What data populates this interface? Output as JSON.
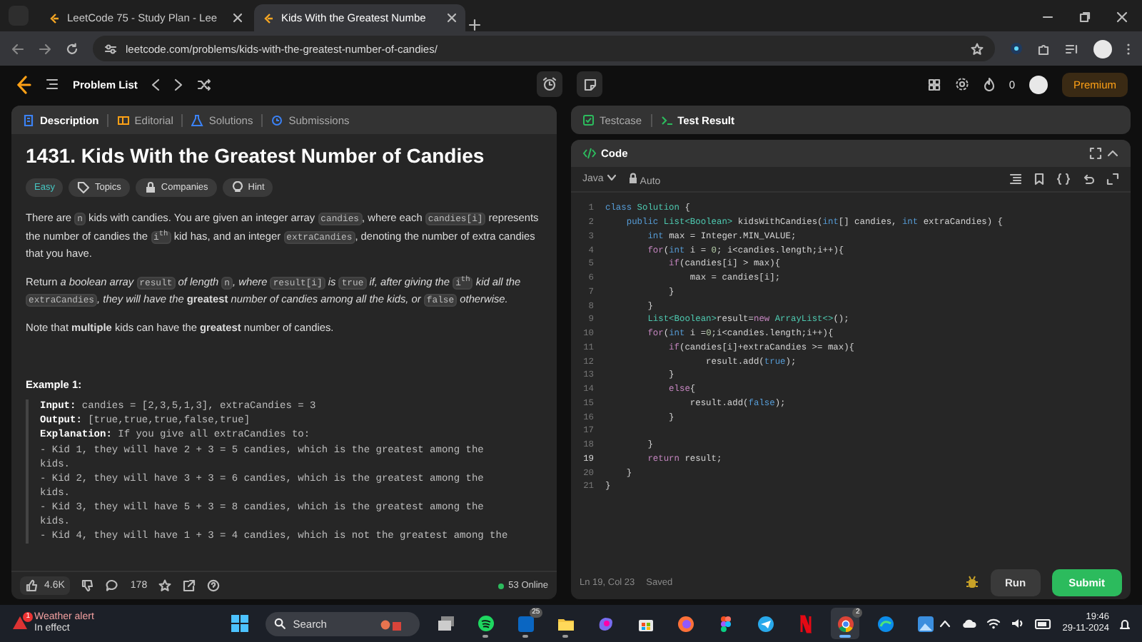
{
  "browser": {
    "tabs": [
      {
        "title": "LeetCode 75 - Study Plan - Lee",
        "selected": false
      },
      {
        "title": "Kids With the Greatest Numbe",
        "selected": true
      }
    ],
    "url": "leetcode.com/problems/kids-with-the-greatest-number-of-candies/"
  },
  "navbar": {
    "problem_list": "Problem List",
    "streak": "0",
    "premium": "Premium"
  },
  "description_panel": {
    "tabs": [
      {
        "label": "Description",
        "kind": "doc",
        "selected": true
      },
      {
        "label": "Editorial",
        "kind": "book",
        "selected": false
      },
      {
        "label": "Solutions",
        "kind": "flask",
        "selected": false
      },
      {
        "label": "Submissions",
        "kind": "clock",
        "selected": false
      }
    ],
    "title": "1431. Kids With the Greatest Number of Candies",
    "difficulty": "Easy",
    "chips": [
      {
        "label": "Topics",
        "kind": "tag"
      },
      {
        "label": "Companies",
        "kind": "lock"
      },
      {
        "label": "Hint",
        "kind": "bulb"
      }
    ],
    "paragraphs": [
      [
        {
          "kind": "text",
          "text": "There are "
        },
        {
          "kind": "code",
          "text": "n"
        },
        {
          "kind": "text",
          "text": " kids with candies. You are given an integer array "
        },
        {
          "kind": "code",
          "text": "candies"
        },
        {
          "kind": "text",
          "text": ", where each "
        },
        {
          "kind": "code",
          "text": "candies[i]"
        },
        {
          "kind": "text",
          "text": " represents the number of candies the "
        },
        {
          "kind": "code",
          "text": "i$^{th}$"
        },
        {
          "kind": "text",
          "text": " kid has, and an integer "
        },
        {
          "kind": "code",
          "text": "extraCandies"
        },
        {
          "kind": "text",
          "text": ", denoting the number of extra candies that you have."
        }
      ],
      [
        {
          "kind": "text",
          "text": "Return *a boolean array* "
        },
        {
          "kind": "code",
          "text": "result"
        },
        {
          "kind": "text",
          "text": " *of length* "
        },
        {
          "kind": "code",
          "text": "n"
        },
        {
          "kind": "text",
          "text": "*, where* "
        },
        {
          "kind": "code",
          "text": "result[i]"
        },
        {
          "kind": "text",
          "text": " *is* "
        },
        {
          "kind": "code",
          "text": "true"
        },
        {
          "kind": "text",
          "text": " *if, after giving the* "
        },
        {
          "kind": "code",
          "text": "i$^{th}$"
        },
        {
          "kind": "text",
          "text": " *kid all the* "
        },
        {
          "kind": "code",
          "text": "extraCandies"
        },
        {
          "kind": "text",
          "text": "*, they will have the* **greatest** *number of candies among all the kids, or* "
        },
        {
          "kind": "code",
          "text": "false"
        },
        {
          "kind": "text",
          "text": " *otherwise.*"
        }
      ],
      [
        {
          "kind": "text",
          "text": "Note that **multiple** kids can have the **greatest** number of candies."
        }
      ]
    ],
    "example": {
      "heading": "Example 1:",
      "lines": [
        "**Input:** candies = [2,3,5,1,3], extraCandies = 3",
        "**Output:** [true,true,true,false,true]",
        "**Explanation:** If you give all extraCandies to:",
        "- Kid 1, they will have 2 + 3 = 5 candies, which is the greatest among the",
        "kids.",
        "- Kid 2, they will have 3 + 3 = 6 candies, which is the greatest among the",
        "kids.",
        "- Kid 3, they will have 5 + 3 = 8 candies, which is the greatest among the",
        "kids.",
        "- Kid 4, they will have 1 + 3 = 4 candies, which is not the greatest among the"
      ]
    },
    "footer": {
      "likes": "4.6K",
      "comments": "178",
      "online": "53 Online"
    }
  },
  "result_panel": {
    "tabs": [
      {
        "label": "Testcase",
        "kind": "check",
        "selected": false
      },
      {
        "label": "Test Result",
        "kind": "prompt",
        "selected": true
      }
    ]
  },
  "code_panel": {
    "title": "Code",
    "language": "Java",
    "mode": "Auto",
    "lines": [
      {
        "number": "1",
        "current": false,
        "tokens": [
          {
            "text": "class ",
            "kind": "keyword"
          },
          {
            "text": "Solution",
            "kind": "type"
          },
          {
            "text": " {",
            "kind": "plain"
          }
        ]
      },
      {
        "number": "2",
        "current": false,
        "tokens": [
          {
            "text": "    public ",
            "kind": "keyword"
          },
          {
            "text": "List<Boolean>",
            "kind": "type"
          },
          {
            "text": " kidsWithCandies(",
            "kind": "plain"
          },
          {
            "text": "int",
            "kind": "keyword"
          },
          {
            "text": "[] candies, ",
            "kind": "plain"
          },
          {
            "text": "int",
            "kind": "keyword"
          },
          {
            "text": " extraCandies) {",
            "kind": "plain"
          }
        ]
      },
      {
        "number": "3",
        "current": false,
        "tokens": [
          {
            "text": "        int ",
            "kind": "keyword"
          },
          {
            "text": "max = Integer.MIN_VALUE;",
            "kind": "plain"
          }
        ]
      },
      {
        "number": "4",
        "current": false,
        "tokens": [
          {
            "text": "        for",
            "kind": "control"
          },
          {
            "text": "(",
            "kind": "plain"
          },
          {
            "text": "int",
            "kind": "keyword"
          },
          {
            "text": " i = ",
            "kind": "plain"
          },
          {
            "text": "0",
            "kind": "number"
          },
          {
            "text": "; i<candies.length;i++){",
            "kind": "plain"
          }
        ]
      },
      {
        "number": "5",
        "current": false,
        "tokens": [
          {
            "text": "            if",
            "kind": "control"
          },
          {
            "text": "(candies[i] > max){",
            "kind": "plain"
          }
        ]
      },
      {
        "number": "6",
        "current": false,
        "tokens": [
          {
            "text": "                max = candies[i];",
            "kind": "plain"
          }
        ]
      },
      {
        "number": "7",
        "current": false,
        "tokens": [
          {
            "text": "            }",
            "kind": "plain"
          }
        ]
      },
      {
        "number": "8",
        "current": false,
        "tokens": [
          {
            "text": "        }",
            "kind": "plain"
          }
        ]
      },
      {
        "number": "9",
        "current": false,
        "tokens": [
          {
            "text": "        List<Boolean>",
            "kind": "type"
          },
          {
            "text": "result=",
            "kind": "plain"
          },
          {
            "text": "new ",
            "kind": "control"
          },
          {
            "text": "ArrayList<>",
            "kind": "type"
          },
          {
            "text": "();",
            "kind": "plain"
          }
        ]
      },
      {
        "number": "10",
        "current": false,
        "tokens": [
          {
            "text": "        for",
            "kind": "control"
          },
          {
            "text": "(",
            "kind": "plain"
          },
          {
            "text": "int",
            "kind": "keyword"
          },
          {
            "text": " i =",
            "kind": "plain"
          },
          {
            "text": "0",
            "kind": "number"
          },
          {
            "text": ";i<candies.length;i++){",
            "kind": "plain"
          }
        ]
      },
      {
        "number": "11",
        "current": false,
        "tokens": [
          {
            "text": "            if",
            "kind": "control"
          },
          {
            "text": "(candies[i]+extraCandies >= max){",
            "kind": "plain"
          }
        ]
      },
      {
        "number": "12",
        "current": false,
        "tokens": [
          {
            "text": "                   result.add(",
            "kind": "plain"
          },
          {
            "text": "true",
            "kind": "keyword"
          },
          {
            "text": ");",
            "kind": "plain"
          }
        ]
      },
      {
        "number": "13",
        "current": false,
        "tokens": [
          {
            "text": "            }",
            "kind": "plain"
          }
        ]
      },
      {
        "number": "14",
        "current": false,
        "tokens": [
          {
            "text": "            else",
            "kind": "control"
          },
          {
            "text": "{",
            "kind": "plain"
          }
        ]
      },
      {
        "number": "15",
        "current": false,
        "tokens": [
          {
            "text": "                result.add(",
            "kind": "plain"
          },
          {
            "text": "false",
            "kind": "keyword"
          },
          {
            "text": ");",
            "kind": "plain"
          }
        ]
      },
      {
        "number": "16",
        "current": false,
        "tokens": [
          {
            "text": "            }",
            "kind": "plain"
          }
        ]
      },
      {
        "number": "17",
        "current": false
      },
      {
        "number": "18",
        "current": false,
        "tokens": [
          {
            "text": "        }",
            "kind": "plain"
          }
        ]
      },
      {
        "number": "19",
        "current": true,
        "tokens": [
          {
            "text": "        return ",
            "kind": "control"
          },
          {
            "text": "result;",
            "kind": "plain"
          }
        ]
      },
      {
        "number": "20",
        "current": false,
        "tokens": [
          {
            "text": "    }",
            "kind": "plain"
          }
        ]
      },
      {
        "number": "21",
        "current": false,
        "tokens": [
          {
            "text": "}",
            "kind": "plain"
          }
        ]
      }
    ],
    "status": {
      "position": "Ln 19, Col 23",
      "saved": "Saved"
    },
    "buttons": [
      {
        "label": "Run",
        "kind": "secondary"
      },
      {
        "label": "Submit",
        "kind": "primary"
      }
    ]
  },
  "taskbar": {
    "weather": {
      "badge": "1",
      "title": "Weather alert",
      "subtitle": "In effect"
    },
    "search": {
      "placeholder": "Search"
    },
    "apps": [
      {
        "kind": "taskview",
        "running": false,
        "selected": false
      },
      {
        "kind": "spotify",
        "running": true,
        "selected": false
      },
      {
        "kind": "linkedin",
        "badge": "25",
        "running": true,
        "selected": false
      },
      {
        "kind": "folder",
        "running": true,
        "selected": false
      },
      {
        "kind": "copilot",
        "running": false,
        "selected": false
      },
      {
        "kind": "store",
        "running": false,
        "selected": false
      },
      {
        "kind": "firefox",
        "running": false,
        "selected": false
      },
      {
        "kind": "figma",
        "running": false,
        "selected": false
      },
      {
        "kind": "telegram",
        "running": false,
        "selected": false
      },
      {
        "kind": "netflix",
        "running": false,
        "selected": false
      },
      {
        "kind": "chrome",
        "badge": "2",
        "running": true,
        "selected": true
      },
      {
        "kind": "edge",
        "running": false,
        "selected": false
      },
      {
        "kind": "photos",
        "running": false,
        "selected": false
      }
    ],
    "time": "19:46",
    "date": "29-11-2024"
  }
}
